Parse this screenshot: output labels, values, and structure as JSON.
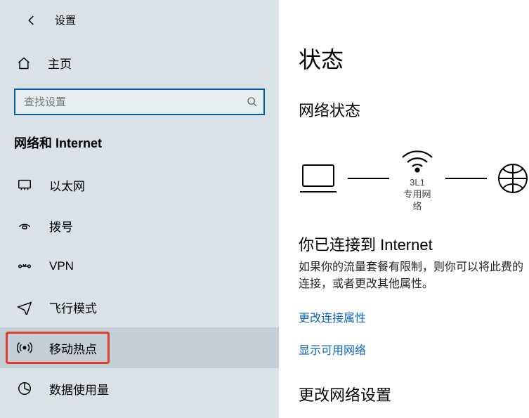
{
  "topbar": {
    "title": "设置"
  },
  "home": {
    "label": "主页"
  },
  "search": {
    "placeholder": "查找设置"
  },
  "section": {
    "title": "网络和 Internet"
  },
  "nav": [
    {
      "id": "ethernet",
      "label": "以太网"
    },
    {
      "id": "dialup",
      "label": "拨号"
    },
    {
      "id": "vpn",
      "label": "VPN"
    },
    {
      "id": "airplane",
      "label": "飞行模式"
    },
    {
      "id": "hotspot",
      "label": "移动热点",
      "selected": true
    },
    {
      "id": "datausage",
      "label": "数据使用量"
    }
  ],
  "main": {
    "title": "状态",
    "subtitle": "网络状态",
    "diagram": {
      "wifi_name": "3L1",
      "wifi_sub": "专用网络"
    },
    "connected_title": "你已连接到 Internet",
    "connected_desc": "如果你的流量套餐有限制，则你可以将此费的连接，或者更改其他属性。",
    "link1": "更改连接属性",
    "link2": "显示可用网络",
    "section2": "更改网络设置"
  }
}
